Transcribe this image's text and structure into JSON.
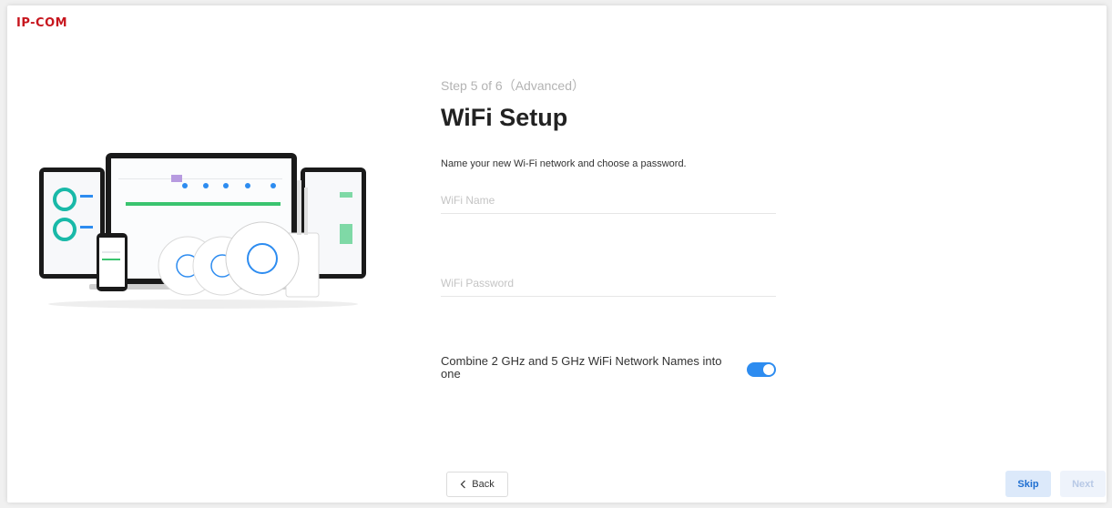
{
  "brand": {
    "logo_text": "IP-COM",
    "logo_color": "#c7161e"
  },
  "wizard": {
    "step_label": "Step 5 of 6（Advanced）",
    "title": "WiFi Setup",
    "subtitle": "Name your new Wi-Fi network and choose a password."
  },
  "form": {
    "wifi_name": {
      "value": "",
      "placeholder": "WiFi Name"
    },
    "wifi_password": {
      "value": "",
      "placeholder": "WiFi Password"
    },
    "combine": {
      "label": "Combine 2 GHz and 5 GHz WiFi Network Names into one",
      "enabled": true
    }
  },
  "footer": {
    "back_icon": "chevron-left-icon",
    "back_label": "Back",
    "skip_label": "Skip",
    "next_label": "Next"
  },
  "colors": {
    "accent": "#2d8cf0",
    "skip_bg": "#dce9fa",
    "next_bg": "#eef3fb"
  }
}
